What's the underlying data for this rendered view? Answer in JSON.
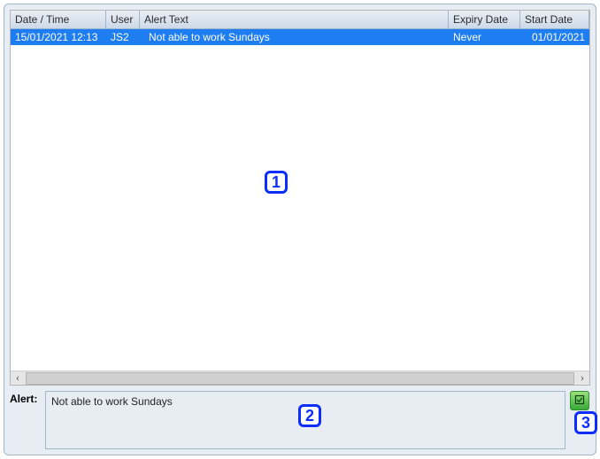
{
  "table": {
    "headers": {
      "datetime": "Date / Time",
      "user": "User",
      "text": "Alert Text",
      "expiry": "Expiry Date",
      "start": "Start Date"
    },
    "rows": [
      {
        "datetime": "15/01/2021 12:13",
        "user": "JS2",
        "text": "Not able to work Sundays",
        "expiry": "Never",
        "start": "01/01/2021"
      }
    ]
  },
  "callouts": {
    "c1": "1",
    "c2": "2",
    "c3": "3"
  },
  "alert": {
    "label": "Alert:",
    "value": "Not able to work Sundays"
  },
  "scroll": {
    "left": "‹",
    "right": "›"
  }
}
